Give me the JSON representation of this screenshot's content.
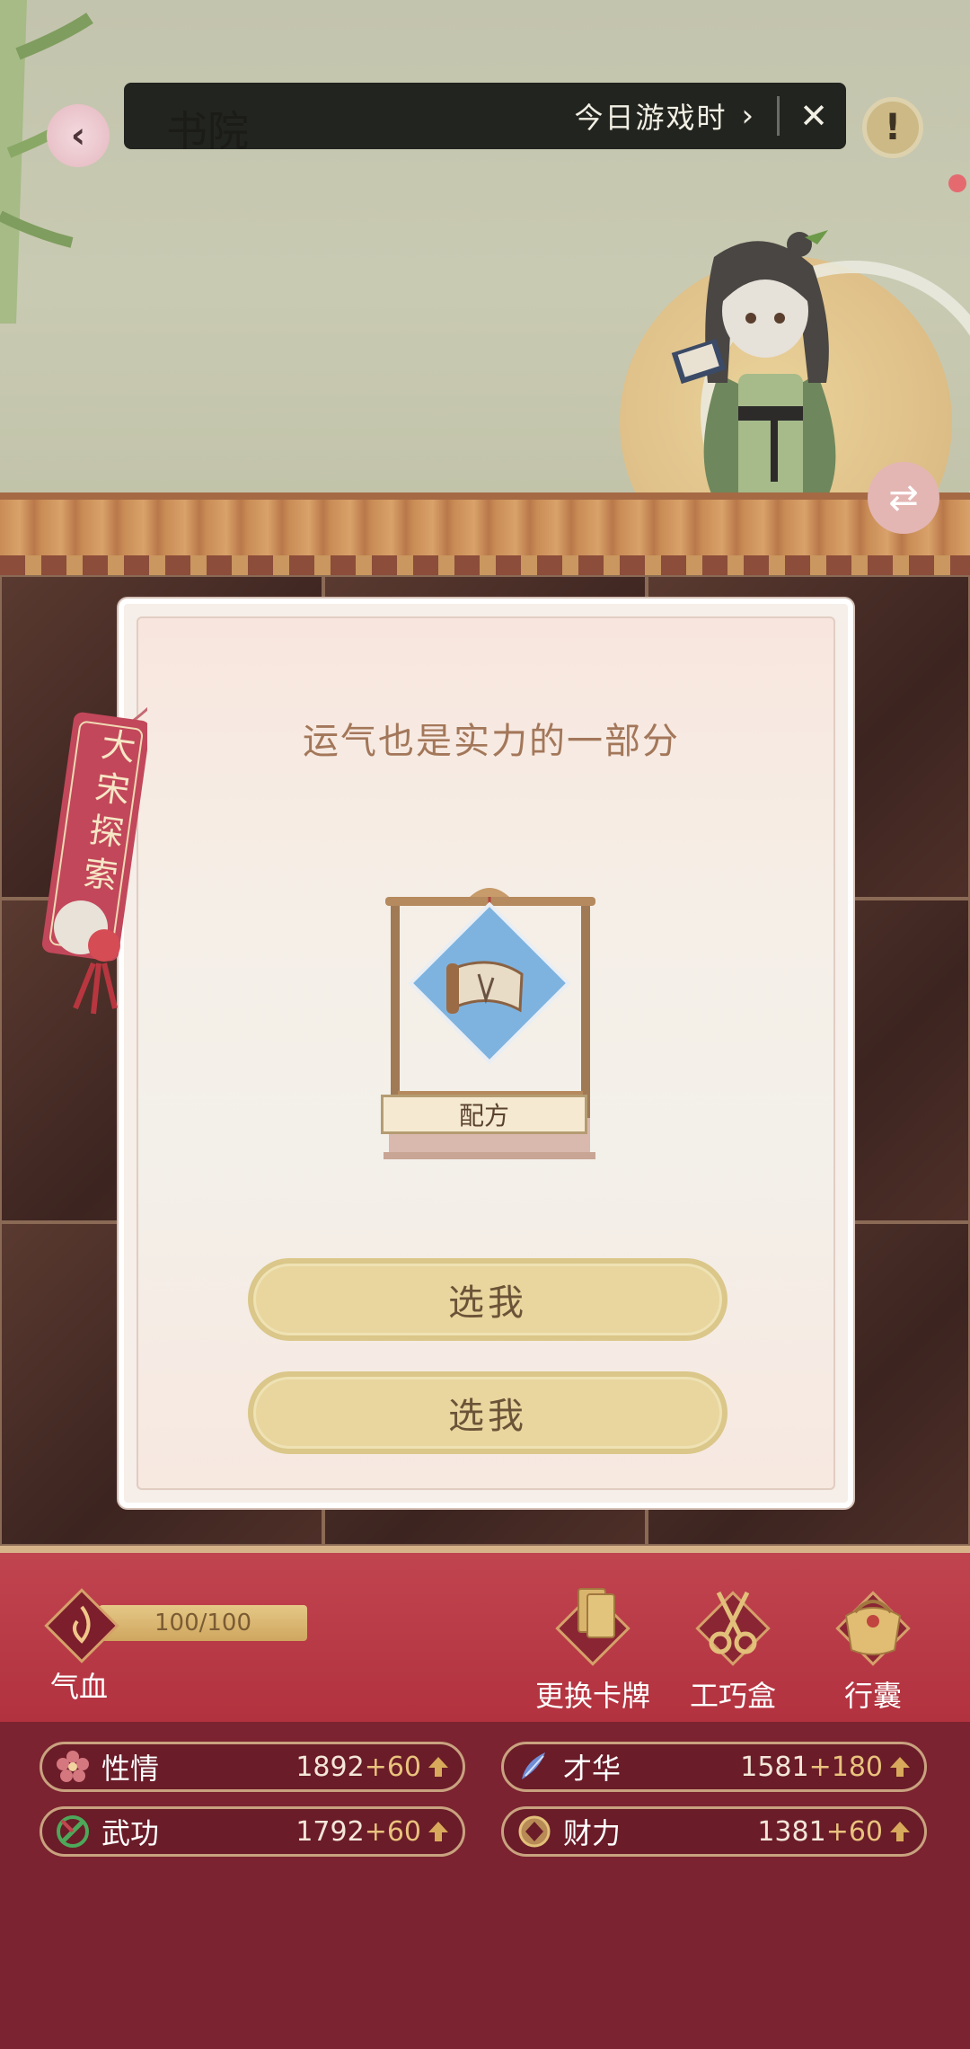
{
  "header": {
    "scene_title": "书院",
    "playtime_label": "今日游戏时",
    "chevron": "›",
    "close": "✕",
    "alert": "!"
  },
  "modal": {
    "title": "运气也是实力的一部分",
    "card_label": "配方",
    "choices": [
      "选我",
      "选我"
    ]
  },
  "bookmark": {
    "label": "大宋探索"
  },
  "hp": {
    "label": "气血",
    "value_text": "100/100",
    "fraction": 1.0
  },
  "tools": [
    {
      "label": "更换卡牌",
      "icon": "cards-icon"
    },
    {
      "label": "工巧盒",
      "icon": "scissors-icon"
    },
    {
      "label": "行囊",
      "icon": "bag-icon"
    }
  ],
  "stats": [
    {
      "name": "性情",
      "value": "1892",
      "bonus": "+60",
      "icon": "plum-flower-icon"
    },
    {
      "name": "才华",
      "value": "1581",
      "bonus": "+180",
      "icon": "brush-icon"
    },
    {
      "name": "武功",
      "value": "1792",
      "bonus": "+60",
      "icon": "sword-icon"
    },
    {
      "name": "财力",
      "value": "1381",
      "bonus": "+60",
      "icon": "coin-icon"
    }
  ],
  "colors": {
    "panel_red": "#b2323f",
    "stats_bg": "#7b2330",
    "gold": "#e9c27d",
    "button_gold": "#e8d69e"
  }
}
